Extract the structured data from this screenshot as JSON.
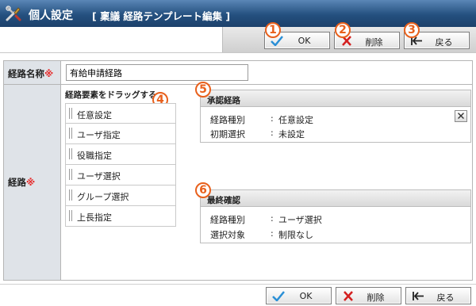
{
  "title": {
    "main": "個人設定",
    "sub": "[ 稟議 経路テンプレート編集 ]",
    "icon": "tools-icon"
  },
  "toolbar": {
    "ok_label": "OK",
    "delete_label": "削除",
    "back_label": "戻る"
  },
  "badges": [
    "1",
    "2",
    "3",
    "4",
    "5",
    "6"
  ],
  "form": {
    "name_label": "経路名称",
    "required_mark": "※",
    "name_value": "有給申請経路",
    "route_label": "経路"
  },
  "palette": {
    "title": "経路要素をドラッグする",
    "items": [
      "任意設定",
      "ユーザ指定",
      "役職指定",
      "ユーザ選択",
      "グループ選択",
      "上長指定"
    ]
  },
  "panels": {
    "approval": {
      "title": "承認経路",
      "rows": [
        {
          "key": "経路種別",
          "sep": ":",
          "value": "任意設定"
        },
        {
          "key": "初期選択",
          "sep": ":",
          "value": "未設定"
        }
      ]
    },
    "final": {
      "title": "最終確認",
      "rows": [
        {
          "key": "経路種別",
          "sep": ":",
          "value": "ユーザ選択"
        },
        {
          "key": "選択対象",
          "sep": ":",
          "value": "制限なし"
        }
      ]
    }
  },
  "colors": {
    "titlebar": "#24507f",
    "badge": "#e8601c",
    "required": "#e62a2a",
    "ok_check": "#2a8fd6",
    "delete_x": "#d42020"
  }
}
